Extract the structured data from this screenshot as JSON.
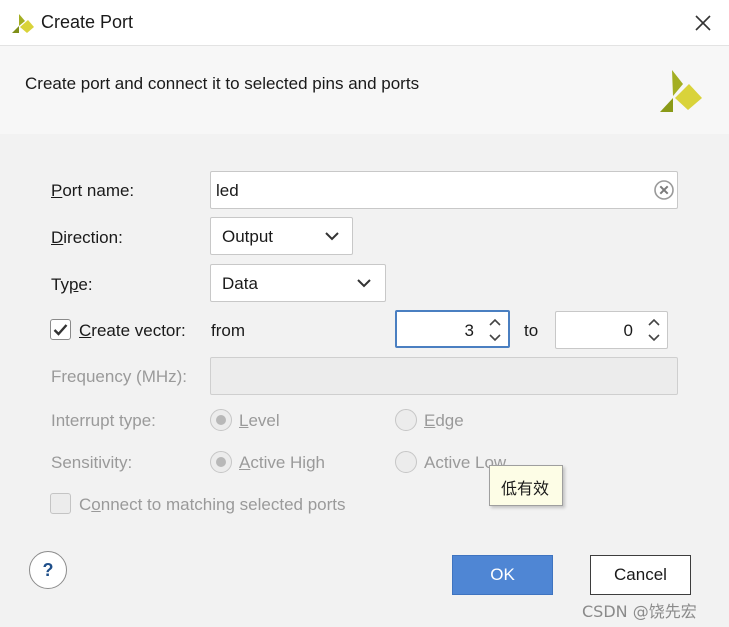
{
  "window": {
    "title": "Create Port"
  },
  "header": {
    "subtitle": "Create port and connect it to selected pins and ports"
  },
  "form": {
    "port_name": {
      "label_u": "P",
      "label_rest": "ort name:",
      "value": "led"
    },
    "direction": {
      "label_u": "D",
      "label_rest": "irection:",
      "value": "Output"
    },
    "type": {
      "label_pre": "Ty",
      "label_u": "p",
      "label_rest": "e:",
      "value": "Data"
    },
    "create_vector": {
      "label_u": "C",
      "label_rest": "reate vector:",
      "checked": true,
      "from_label": "from",
      "from_value": "3",
      "to_label": "to",
      "to_value": "0"
    },
    "frequency": {
      "label": "Frequency (MHz):",
      "value": ""
    },
    "interrupt_type": {
      "label": "Interrupt type:",
      "options": [
        {
          "u": "L",
          "rest": "evel",
          "selected": true
        },
        {
          "u": "E",
          "rest": "dge",
          "selected": false
        }
      ]
    },
    "sensitivity": {
      "label": "Sensitivity:",
      "options": [
        {
          "u": "A",
          "rest": "ctive High",
          "selected": true
        },
        {
          "u": "",
          "rest": "Active Low",
          "selected": false
        }
      ]
    },
    "connect_matching": {
      "label_pre": "C",
      "label_u": "o",
      "label_rest": "nnect to matching selected ports",
      "checked": false
    }
  },
  "tooltip": {
    "text": "低有效"
  },
  "buttons": {
    "help": "?",
    "ok": "OK",
    "cancel": "Cancel"
  },
  "watermark": "CSDN @饶先宏",
  "colors": {
    "accent": "#4f86d4",
    "focus": "#4a7fc1",
    "brand_green": "#9aa51e",
    "brand_yellow": "#d9d33a"
  }
}
